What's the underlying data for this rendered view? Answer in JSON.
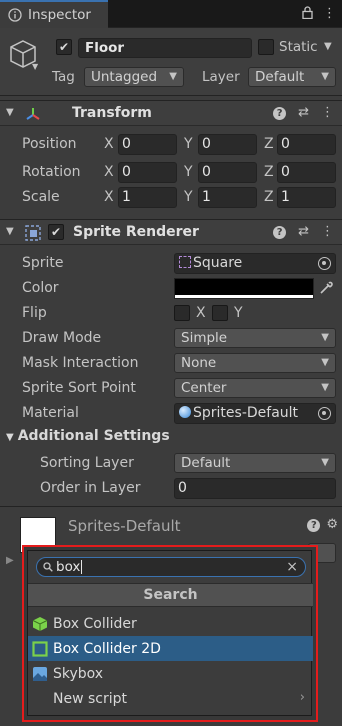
{
  "tab": {
    "label": "Inspector"
  },
  "object": {
    "name": "Floor",
    "static_label": "Static",
    "tag_label": "Tag",
    "tag_value": "Untagged",
    "layer_label": "Layer",
    "layer_value": "Default"
  },
  "transform": {
    "title": "Transform",
    "rows": [
      {
        "label": "Position",
        "x": "0",
        "y": "0",
        "z": "0"
      },
      {
        "label": "Rotation",
        "x": "0",
        "y": "0",
        "z": "0"
      },
      {
        "label": "Scale",
        "x": "1",
        "y": "1",
        "z": "1"
      }
    ],
    "axes": [
      "X",
      "Y",
      "Z"
    ]
  },
  "sprite_renderer": {
    "title": "Sprite Renderer",
    "sprite_label": "Sprite",
    "sprite_value": "Square",
    "color_label": "Color",
    "flip_label": "Flip",
    "flip_x": "X",
    "flip_y": "Y",
    "draw_mode_label": "Draw Mode",
    "draw_mode_value": "Simple",
    "mask_label": "Mask Interaction",
    "mask_value": "None",
    "sort_point_label": "Sprite Sort Point",
    "sort_point_value": "Center",
    "material_label": "Material",
    "material_value": "Sprites-Default",
    "additional_label": "Additional Settings",
    "sorting_layer_label": "Sorting Layer",
    "sorting_layer_value": "Default",
    "order_label": "Order in Layer",
    "order_value": "0"
  },
  "material_preview": {
    "name": "Sprites-Default"
  },
  "add_component_popup": {
    "query": "box",
    "title": "Search",
    "results": [
      {
        "label": "Box Collider",
        "icon": "box-collider-icon"
      },
      {
        "label": "Box Collider 2D",
        "icon": "box-collider-2d-icon",
        "selected": true
      },
      {
        "label": "Skybox",
        "icon": "skybox-icon"
      },
      {
        "label": "New script",
        "icon": "none"
      }
    ]
  },
  "colors": {
    "accent": "#3a72b0",
    "selection": "#2c5d87",
    "highlight_border": "#e51c1c"
  }
}
